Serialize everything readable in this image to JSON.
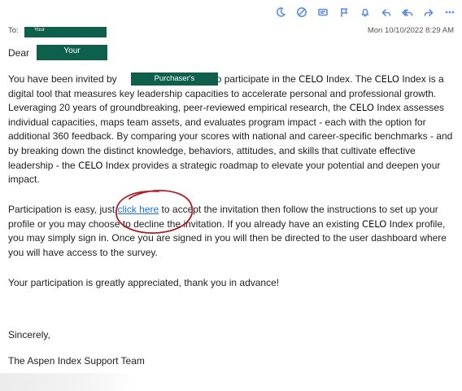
{
  "toolbar": {
    "icons": [
      "moon-icon",
      "block-icon",
      "tag-icon",
      "flag-icon",
      "bell-icon",
      "reply-icon",
      "reply-all-icon",
      "forward-icon",
      "more-icon"
    ]
  },
  "header": {
    "to_label": "To:",
    "to_tag": "Your",
    "date": "Mon 10/10/2022 8:29 AM"
  },
  "greeting": {
    "dear": "Dear",
    "name_tag": "Your"
  },
  "paragraph1": {
    "s1": "You have been invited by",
    "purchaser_tag": "Purchaser's",
    "s2": "to participate in the",
    "kw": "CELO",
    "s3": "Index. The",
    "s4": "Index is a digital tool that measures key leadership capacities to accelerate personal and professional growth. Leveraging 20 years of groundbreaking, peer-reviewed empirical research, the",
    "s5": "Index assesses individual capacities, maps team assets, and evaluates program impact - each with the option for additional 360 feedback. By comparing your scores with national and career-specific benchmarks - and by breaking down the distinct knowledge, behaviors, attitudes, and skills that cultivate effective leadership - the",
    "s6": "Index provides a strategic roadmap to elevate your potential and deepen your impact."
  },
  "paragraph2": {
    "s1": "Participation is easy, just",
    "link": "click here",
    "s2": "to accept the invitation then follow the instructions to set up your profile or you may choose to decline the invitation. If you already have an existing",
    "s3": "Index profile, you may simply sign in. Once you are signed in you will then be directed to the user dashboard where you will have access to the survey."
  },
  "paragraph3": "Your participation is greatly appreciated, thank you in advance!",
  "closing": "Sincerely,",
  "signature": "The Aspen Index Support Team",
  "colors": {
    "tag_bg": "#0f5f4d",
    "link": "#1a73e8",
    "icon": "#5b8ee6",
    "circle": "#b0202a"
  }
}
